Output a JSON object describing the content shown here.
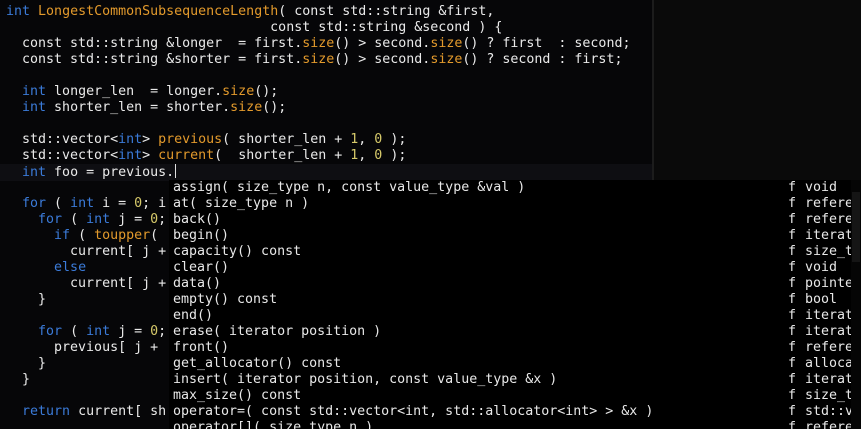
{
  "colors": {
    "background": "#060608",
    "text": "#eaeaea",
    "keyword": "#3b7bd9",
    "function": "#e39a2c",
    "number": "#d6c96a",
    "popup_background": "#000000"
  },
  "editor": {
    "lines": [
      {
        "spans": [
          {
            "t": "int",
            "c": "kw"
          },
          {
            "t": " "
          },
          {
            "t": "LongestCommonSubsequenceLength",
            "c": "fn"
          },
          {
            "t": "( const std::string &first,"
          }
        ]
      },
      {
        "spans": [
          {
            "t": "                                 const std::string &second ) {"
          }
        ]
      },
      {
        "spans": [
          {
            "t": "  const std::string &longer  = first."
          },
          {
            "t": "size",
            "c": "fn"
          },
          {
            "t": "() > second."
          },
          {
            "t": "size",
            "c": "fn"
          },
          {
            "t": "() ? first  : second;"
          }
        ]
      },
      {
        "spans": [
          {
            "t": "  const std::string &shorter = first."
          },
          {
            "t": "size",
            "c": "fn"
          },
          {
            "t": "() > second."
          },
          {
            "t": "size",
            "c": "fn"
          },
          {
            "t": "() ? second : first;"
          }
        ]
      },
      {
        "spans": [
          {
            "t": ""
          }
        ]
      },
      {
        "spans": [
          {
            "t": "  "
          },
          {
            "t": "int",
            "c": "kw"
          },
          {
            "t": " longer_len  = longer."
          },
          {
            "t": "size",
            "c": "fn"
          },
          {
            "t": "();"
          }
        ]
      },
      {
        "spans": [
          {
            "t": "  "
          },
          {
            "t": "int",
            "c": "kw"
          },
          {
            "t": " shorter_len = shorter."
          },
          {
            "t": "size",
            "c": "fn"
          },
          {
            "t": "();"
          }
        ]
      },
      {
        "spans": [
          {
            "t": ""
          }
        ]
      },
      {
        "spans": [
          {
            "t": "  std::vector<"
          },
          {
            "t": "int",
            "c": "kw"
          },
          {
            "t": "> "
          },
          {
            "t": "previous",
            "c": "fn"
          },
          {
            "t": "( shorter_len + "
          },
          {
            "t": "1",
            "c": "num"
          },
          {
            "t": ", "
          },
          {
            "t": "0",
            "c": "num"
          },
          {
            "t": " );"
          }
        ]
      },
      {
        "spans": [
          {
            "t": "  std::vector<"
          },
          {
            "t": "int",
            "c": "kw"
          },
          {
            "t": "> "
          },
          {
            "t": "current",
            "c": "fn"
          },
          {
            "t": "(  shorter_len + "
          },
          {
            "t": "1",
            "c": "num"
          },
          {
            "t": ", "
          },
          {
            "t": "0",
            "c": "num"
          },
          {
            "t": " );"
          }
        ]
      },
      {
        "spans": [
          {
            "t": "  "
          },
          {
            "t": "int",
            "c": "kw"
          },
          {
            "t": " foo = previous."
          }
        ],
        "cursor": true
      },
      {
        "spans": [
          {
            "t": ""
          }
        ]
      },
      {
        "spans": [
          {
            "t": "  "
          },
          {
            "t": "for",
            "c": "kw"
          },
          {
            "t": " ( "
          },
          {
            "t": "int",
            "c": "kw"
          },
          {
            "t": " i = "
          },
          {
            "t": "0",
            "c": "num"
          },
          {
            "t": "; i"
          }
        ]
      },
      {
        "spans": [
          {
            "t": "    "
          },
          {
            "t": "for",
            "c": "kw"
          },
          {
            "t": " ( "
          },
          {
            "t": "int",
            "c": "kw"
          },
          {
            "t": " j = "
          },
          {
            "t": "0",
            "c": "num"
          },
          {
            "t": "; j"
          }
        ]
      },
      {
        "spans": [
          {
            "t": "      "
          },
          {
            "t": "if",
            "c": "kw"
          },
          {
            "t": " ( "
          },
          {
            "t": "toupper",
            "c": "fn"
          },
          {
            "t": "("
          }
        ]
      },
      {
        "spans": [
          {
            "t": "        current[ j +"
          }
        ]
      },
      {
        "spans": [
          {
            "t": "      "
          },
          {
            "t": "else",
            "c": "kw"
          }
        ]
      },
      {
        "spans": [
          {
            "t": "        current[ j +"
          }
        ]
      },
      {
        "spans": [
          {
            "t": "    }"
          }
        ]
      },
      {
        "spans": [
          {
            "t": ""
          }
        ]
      },
      {
        "spans": [
          {
            "t": "    "
          },
          {
            "t": "for",
            "c": "kw"
          },
          {
            "t": " ( "
          },
          {
            "t": "int",
            "c": "kw"
          },
          {
            "t": " j = "
          },
          {
            "t": "0",
            "c": "num"
          },
          {
            "t": "; j"
          }
        ]
      },
      {
        "spans": [
          {
            "t": "      previous[ j +"
          }
        ]
      },
      {
        "spans": [
          {
            "t": "    }"
          }
        ]
      },
      {
        "spans": [
          {
            "t": "  }"
          }
        ]
      },
      {
        "spans": [
          {
            "t": ""
          }
        ]
      },
      {
        "spans": [
          {
            "t": "  "
          },
          {
            "t": "return",
            "c": "kw"
          },
          {
            "t": " current[ sh"
          }
        ]
      }
    ]
  },
  "completion_menu": {
    "items": [
      {
        "name": "assign( size_type n, const value_type &val )",
        "kind": "f",
        "type": "void"
      },
      {
        "name": "at( size_type n )",
        "kind": "f",
        "type": "referen"
      },
      {
        "name": "back()",
        "kind": "f",
        "type": "referen"
      },
      {
        "name": "begin()",
        "kind": "f",
        "type": "iterato"
      },
      {
        "name": "capacity() const",
        "kind": "f",
        "type": "size_ty"
      },
      {
        "name": "clear()",
        "kind": "f",
        "type": "void"
      },
      {
        "name": "data()",
        "kind": "f",
        "type": "pointer"
      },
      {
        "name": "empty() const",
        "kind": "f",
        "type": "bool"
      },
      {
        "name": "end()",
        "kind": "f",
        "type": "iterato"
      },
      {
        "name": "erase( iterator position )",
        "kind": "f",
        "type": "iterato"
      },
      {
        "name": "front()",
        "kind": "f",
        "type": "referen"
      },
      {
        "name": "get_allocator() const",
        "kind": "f",
        "type": "allocat"
      },
      {
        "name": "insert( iterator position, const value_type &x )",
        "kind": "f",
        "type": "iterato"
      },
      {
        "name": "max_size() const",
        "kind": "f",
        "type": "size_ty"
      },
      {
        "name": "operator=( const std::vector<int, std::allocator<int> > &x )",
        "kind": "f",
        "type": "std::ve"
      },
      {
        "name": "operator[]( size_type n )",
        "kind": "f",
        "type": "referen"
      }
    ]
  }
}
